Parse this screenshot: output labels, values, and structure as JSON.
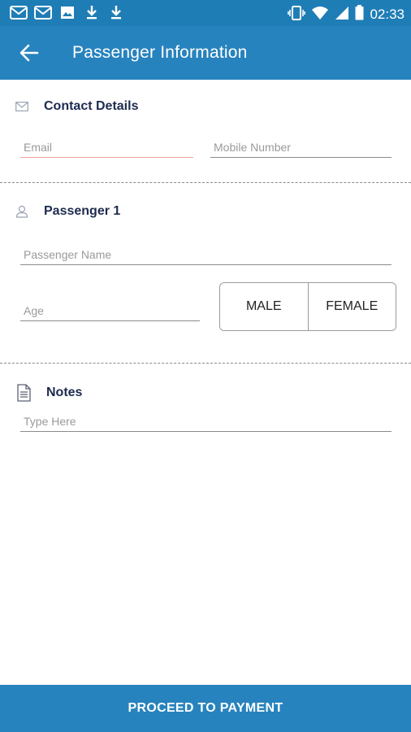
{
  "status_bar": {
    "time": "02:33",
    "left_icons": [
      "mail-icon",
      "mail-icon",
      "image-icon",
      "download-icon",
      "download-icon"
    ],
    "right_icons": [
      "vibrate-icon",
      "wifi-icon",
      "cellular-signal-icon",
      "battery-icon"
    ]
  },
  "app_bar": {
    "title": "Passenger Information",
    "back_icon": "arrow-left-icon"
  },
  "contact": {
    "title": "Contact Details",
    "icon": "envelope-icon",
    "email_placeholder": "Email",
    "mobile_placeholder": "Mobile Number"
  },
  "passenger": {
    "title": "Passenger 1",
    "icon": "person-icon",
    "name_placeholder": "Passenger Name",
    "age_placeholder": "Age",
    "gender_options": [
      "MALE",
      "FEMALE"
    ]
  },
  "notes": {
    "title": "Notes",
    "icon": "document-icon",
    "placeholder": "Type Here"
  },
  "proceed_label": "PROCEED TO PAYMENT",
  "colors": {
    "primary": "#2783be",
    "status_bar": "#1f7db6",
    "section_title": "#1d2b4f",
    "error_underline": "#f0a0a0"
  }
}
